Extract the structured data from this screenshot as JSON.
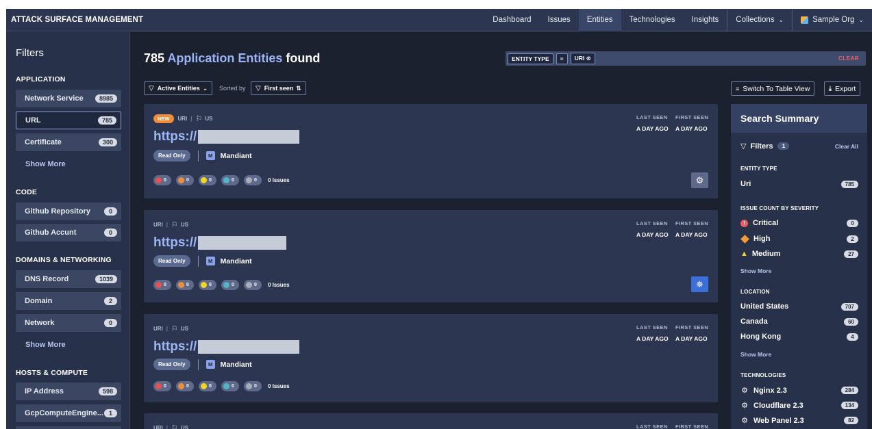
{
  "app": {
    "title": "ATTACK SURFACE MANAGEMENT"
  },
  "nav": {
    "items": [
      "Dashboard",
      "Issues",
      "Entities",
      "Technologies",
      "Insights"
    ],
    "collections": "Collections",
    "org": "Sample Org"
  },
  "sidebar": {
    "title": "Filters",
    "sections": [
      {
        "title": "APPLICATION",
        "items": [
          {
            "label": "Network Service",
            "count": "8985"
          },
          {
            "label": "URL",
            "count": "785"
          },
          {
            "label": "Certificate",
            "count": "300"
          }
        ]
      },
      {
        "title": "CODE",
        "items": [
          {
            "label": "Github Repository",
            "count": "0"
          },
          {
            "label": "Github Accunt",
            "count": "0"
          }
        ]
      },
      {
        "title": "DOMAINS & NETWORKING",
        "items": [
          {
            "label": "DNS Record",
            "count": "1039"
          },
          {
            "label": "Domain",
            "count": "2"
          },
          {
            "label": "Network",
            "count": "0"
          }
        ]
      },
      {
        "title": "HOSTS & COMPUTE",
        "items": [
          {
            "label": "IP Address",
            "count": "598"
          },
          {
            "label": "GcpComputeEngine...",
            "count": "1"
          }
        ]
      }
    ],
    "show_more": "Show More"
  },
  "main": {
    "count": "785",
    "title_accent": "Application Entities",
    "title_rest": "found",
    "filter_chips": [
      "ENTITY TYPE",
      "=",
      "URI ⊗"
    ],
    "clear": "CLEAR",
    "active_entities": "Active Entities",
    "sorted_by": "Sorted by",
    "first_seen_btn": "First seen",
    "switch_view": "Switch To Table View",
    "export": "Export"
  },
  "card_labels": {
    "new": "NEW",
    "type": "URI",
    "country": "US",
    "url_prefix": "https://",
    "read_only": "Read Only",
    "vendor_initial": "M",
    "vendor": "Mandiant",
    "issue_counts": [
      "0",
      "0",
      "0",
      "0",
      "0"
    ],
    "issues": "0 Issues",
    "last_seen_h": "LAST SEEN",
    "first_seen_h": "FIRST SEEN",
    "last_seen": "A DAY AGO",
    "first_seen": "A DAY AGO"
  },
  "severity_colors": [
    "#e8514f",
    "#f08d3a",
    "#f3d522",
    "#4fb6c7",
    "#a8adb8"
  ],
  "summary": {
    "title": "Search Summary",
    "filters": "Filters",
    "filters_count": "1",
    "clear_all": "Clear All",
    "entity_type_h": "ENTITY TYPE",
    "entity_type": {
      "label": "Uri",
      "count": "785"
    },
    "severity_h": "ISSUE COUNT BY SEVERITY",
    "severity": [
      {
        "label": "Critical",
        "count": "0"
      },
      {
        "label": "High",
        "count": "2"
      },
      {
        "label": "Medium",
        "count": "27"
      }
    ],
    "location_h": "LOCATION",
    "location": [
      {
        "label": "United States",
        "count": "707"
      },
      {
        "label": "Canada",
        "count": "60"
      },
      {
        "label": "Hong Kong",
        "count": "4"
      }
    ],
    "technologies_h": "TECHNOLOGIES",
    "technologies": [
      {
        "label": "Nginx 2.3",
        "count": "284"
      },
      {
        "label": "Cloudflare 2.3",
        "count": "134"
      },
      {
        "label": "Web Panel 2.3",
        "count": "82"
      }
    ],
    "show_more": "Show More"
  }
}
